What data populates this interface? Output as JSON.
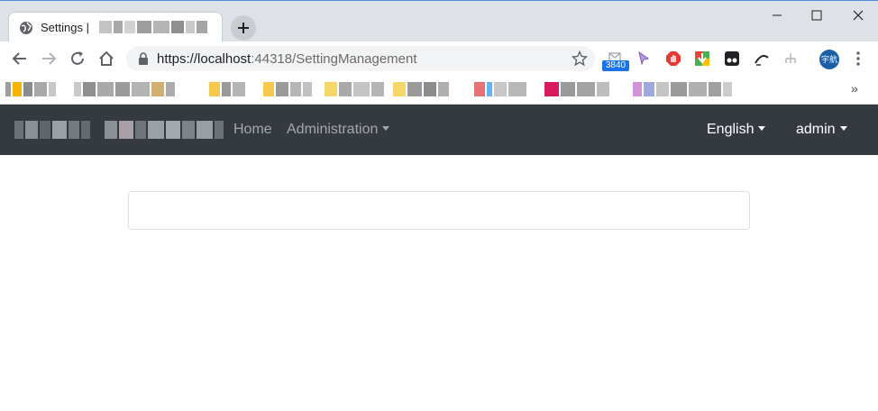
{
  "browser": {
    "tab_title": "Settings |",
    "url_host": "https://localhost",
    "url_port_path": ":44318/SettingManagement",
    "extension_badge": "3840",
    "profile_label": "宇航",
    "bookmarks_overflow": "»"
  },
  "navbar": {
    "home_label": "Home",
    "administration_label": "Administration",
    "language_label": "English",
    "user_label": "admin"
  },
  "colors": {
    "navbar_bg": "#343a40",
    "chrome_bg": "#dee1e6",
    "accent": "#1a73e8"
  }
}
